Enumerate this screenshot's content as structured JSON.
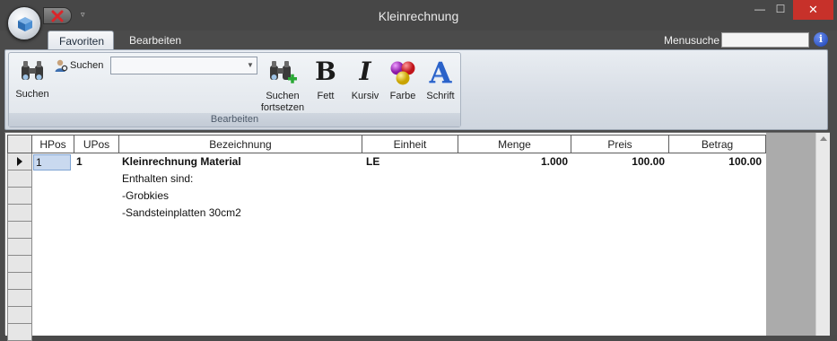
{
  "window": {
    "title": "Kleinrechnung",
    "min_glyph": "—",
    "max_glyph": "☐",
    "close_glyph": "✕"
  },
  "quick_access": {
    "dropdown_glyph": "▿"
  },
  "tabs": [
    {
      "label": "Favoriten",
      "active": true
    },
    {
      "label": "Bearbeiten",
      "active": false
    }
  ],
  "menusuche": {
    "label": "Menusuche",
    "value": "",
    "help_glyph": "i"
  },
  "ribbon": {
    "group_label": "Bearbeiten",
    "suchen_large": "Suchen",
    "suchen_small": "Suchen",
    "combo_value": "",
    "fortsetzen": "Suchen fortsetzen",
    "fett": "Fett",
    "kursiv": "Kursiv",
    "farbe": "Farbe",
    "schrift": "Schrift",
    "fett_glyph": "B",
    "kursiv_glyph": "I",
    "schrift_glyph": "A"
  },
  "grid": {
    "columns": [
      "HPos",
      "UPos",
      "Bezeichnung",
      "Einheit",
      "Menge",
      "Preis",
      "Betrag"
    ],
    "rows": [
      {
        "hpos": "1",
        "upos": "1",
        "bezeichnung": "Kleinrechnung Material",
        "einheit": "LE",
        "menge": "1.000",
        "preis": "100.00",
        "betrag": "100.00"
      }
    ],
    "text_lines": [
      "Enthalten sind:",
      "-Grobkies",
      "-Sandsteinplatten 30cm2"
    ]
  },
  "colors": {
    "accent": "#2a62c9",
    "close_red": "#c7312a",
    "selection": "#c9d9ef"
  }
}
